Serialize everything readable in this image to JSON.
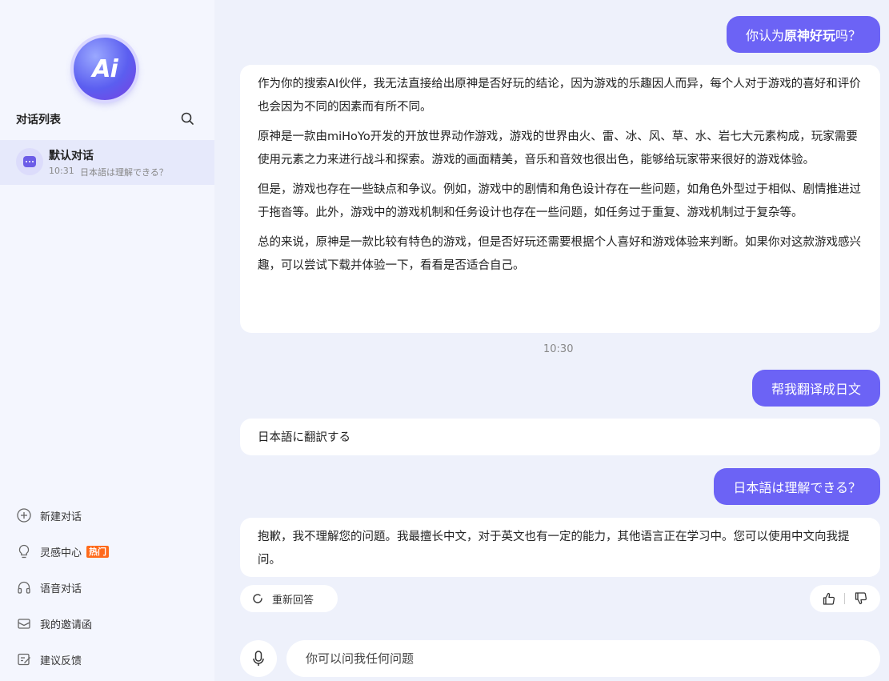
{
  "sidebar": {
    "logo_text": "Ai",
    "list_title": "对话列表",
    "conversation": {
      "name": "默认对话",
      "time": "10:31",
      "preview": "日本語は理解できる？"
    },
    "menu": [
      {
        "label": "新建对话",
        "icon": "plus-circle-icon"
      },
      {
        "label": "灵感中心",
        "icon": "lightbulb-icon",
        "badge": "热门"
      },
      {
        "label": "语音对话",
        "icon": "headphones-icon"
      },
      {
        "label": "我的邀请函",
        "icon": "envelope-icon"
      },
      {
        "label": "建议反馈",
        "icon": "feedback-icon"
      }
    ]
  },
  "chat": {
    "msg1_user": {
      "prefix": "你认为",
      "bold": "原神好玩",
      "suffix": "吗？"
    },
    "msg1_bot": [
      "作为你的搜索AI伙伴，我无法直接给出原神是否好玩的结论，因为游戏的乐趣因人而异，每个人对于游戏的喜好和评价也会因为不同的因素而有所不同。",
      "原神是一款由miHoYo开发的开放世界动作游戏，游戏的世界由火、雷、冰、风、草、水、岩七大元素构成，玩家需要使用元素之力来进行战斗和探索。游戏的画面精美，音乐和音效也很出色，能够给玩家带来很好的游戏体验。",
      "但是，游戏也存在一些缺点和争议。例如，游戏中的剧情和角色设计存在一些问题，如角色外型过于相似、剧情推进过于拖沓等。此外，游戏中的游戏机制和任务设计也存在一些问题，如任务过于重复、游戏机制过于复杂等。",
      "总的来说，原神是一款比较有特色的游戏，但是否好玩还需要根据个人喜好和游戏体验来判断。如果你对这款游戏感兴趣，可以尝试下载并体验一下，看看是否适合自己。"
    ],
    "time_separator": "10:30",
    "msg2_user": "帮我翻译成日文",
    "msg2_bot": "日本語に翻訳する",
    "msg3_user": "日本語は理解できる？",
    "msg3_bot": "抱歉，我不理解您的问题。我最擅长中文，对于英文也有一定的能力，其他语言正在学习中。您可以使用中文向我提问。",
    "regenerate_label": "重新回答",
    "input_placeholder": "你可以问我任何问题"
  },
  "colors": {
    "accent": "#6c63f5",
    "hot_badge": "#ff6a1a",
    "background": "#eef1fb"
  }
}
